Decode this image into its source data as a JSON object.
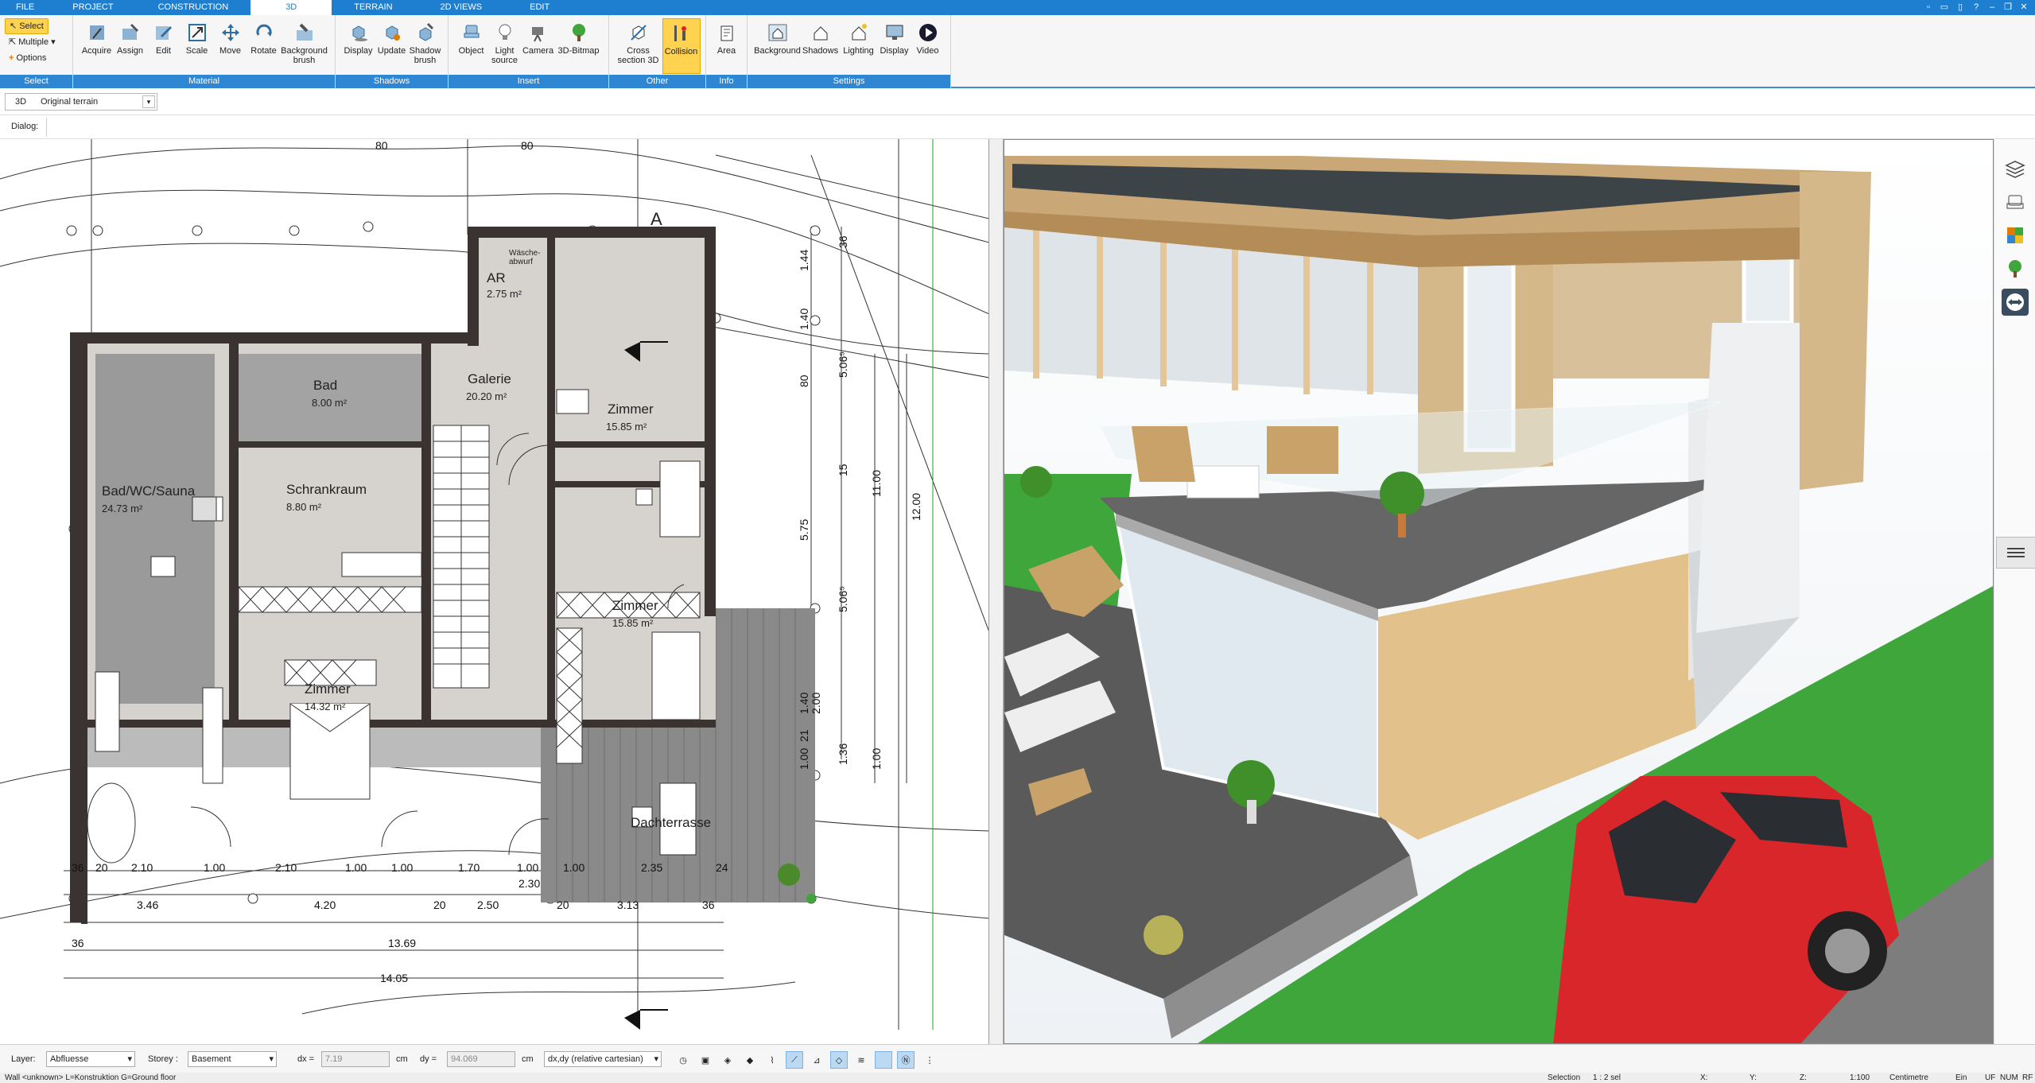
{
  "tabs": [
    {
      "label": "FILE"
    },
    {
      "label": "PROJECT"
    },
    {
      "label": "CONSTRUCTION"
    },
    {
      "label": "3D"
    },
    {
      "label": "TERRAIN"
    },
    {
      "label": "2D VIEWS"
    },
    {
      "label": "EDIT"
    }
  ],
  "ribbon": {
    "select": {
      "select": "Select",
      "multiple": "Multiple",
      "options": "Options",
      "group": "Select"
    },
    "material": {
      "group": "Material",
      "buttons": [
        "Acquire",
        "Assign",
        "Edit",
        "Scale",
        "Move",
        "Rotate",
        "Background brush"
      ]
    },
    "shadows": {
      "group": "Shadows",
      "buttons": [
        "Display",
        "Update",
        "Shadow brush"
      ]
    },
    "insert": {
      "group": "Insert",
      "buttons": [
        "Object",
        "Light source",
        "Camera",
        "3D-Bitmap"
      ]
    },
    "other": {
      "group": "Other",
      "buttons": [
        "Cross section 3D",
        "Collision"
      ]
    },
    "info": {
      "group": "Info",
      "buttons": [
        "Area"
      ]
    },
    "settings": {
      "group": "Settings",
      "buttons": [
        "Background",
        "Shadows",
        "Lighting",
        "Display",
        "Video"
      ]
    }
  },
  "viewbar": {
    "tag": "3D",
    "value": "Original terrain"
  },
  "dialog": {
    "label": "Dialog:"
  },
  "plan": {
    "rooms": [
      {
        "name": "AR",
        "area": "2.75 m²"
      },
      {
        "name": "Bad",
        "area": "8.00 m²"
      },
      {
        "name": "Galerie",
        "area": "20.20 m²"
      },
      {
        "name": "Zimmer",
        "area": "15.85 m²"
      },
      {
        "name": "Bad/WC/Sauna",
        "area": "24.73 m²"
      },
      {
        "name": "Schrankraum",
        "area": "8.80 m²"
      },
      {
        "name": "Zimmer",
        "area": "15.85 m²"
      },
      {
        "name": "Zimmer",
        "area": "14.32 m²"
      },
      {
        "name": "Dachterrasse",
        "area": ""
      }
    ],
    "wasche": "Wäsche-\nabwurf",
    "sectionLabel": "A",
    "dims_top": [
      "80",
      "80"
    ],
    "dims_bottom_row1": [
      "36",
      "20",
      "2.10",
      "1.00",
      "2.10",
      "1.00",
      "1.00",
      "1.70",
      "1.00",
      "1.00",
      "2.35",
      "24"
    ],
    "dims_bottom_row2": [
      "3.46",
      "4.20",
      "20",
      "2.50",
      "2.30",
      "20",
      "3.13",
      "36"
    ],
    "dims_bottom_row3": [
      "36",
      "13.69"
    ],
    "dims_bottom_row4": [
      "14.05"
    ],
    "dims_right": [
      "36",
      "1.44",
      "1.40",
      "80",
      "5.06⁵",
      "15",
      "5.75",
      "11.00",
      "12.00",
      "5.06⁵",
      "1.40",
      "2.00",
      "21",
      "1.36",
      "1.00",
      "1.00"
    ]
  },
  "status": {
    "layerLabel": "Layer:",
    "layer": "Abfluesse",
    "storeyLabel": "Storey :",
    "storey": "Basement",
    "dxLabel": "dx =",
    "dx": "7.19",
    "dyLabel": "dy =",
    "dy": "94.069",
    "unit": "cm",
    "mode": "dx,dy (relative cartesian)"
  },
  "info": {
    "left": "Wall <unknown> L=Konstruktion G=Ground floor",
    "selection": "Selection",
    "sel": "1 : 2 sel",
    "x": "X:",
    "y": "Y:",
    "z": "Z:",
    "scale": "1:100",
    "units": "Centimetre",
    "ein": "Ein",
    "uf": "UF",
    "num": "NUM",
    "rf": "RF"
  },
  "colors": {
    "accent": "#1e7fd0",
    "ribbonGroup": "#2f86d3",
    "highlight": "#ffd24f",
    "roof": "#3d4448",
    "wood": "#c9a777",
    "deck": "#5a5a5a",
    "grass": "#3ea63b",
    "car": "#d8262b"
  }
}
